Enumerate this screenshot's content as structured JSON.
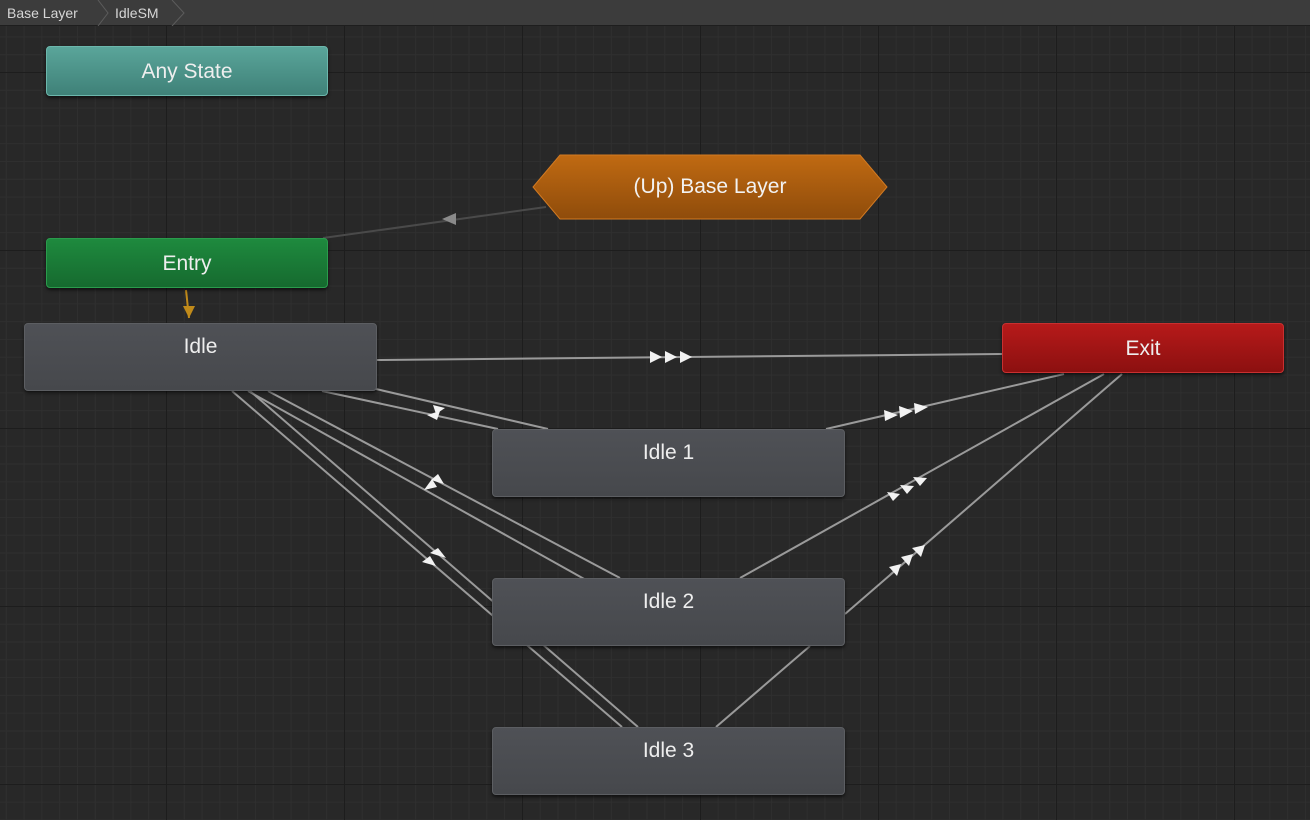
{
  "breadcrumb": {
    "items": [
      "Base Layer",
      "IdleSM"
    ]
  },
  "nodes": {
    "any_state": "Any State",
    "entry": "Entry",
    "up_base_layer": "(Up) Base Layer",
    "idle": "Idle",
    "exit": "Exit",
    "idle1": "Idle 1",
    "idle2": "Idle 2",
    "idle3": "Idle 3"
  },
  "colors": {
    "background": "#282828",
    "any_state": "#4f9a8f",
    "entry": "#1b7d38",
    "exit": "#a01414",
    "state_machine_up": "#b0600f",
    "state": "#4b4d51",
    "transition": "#9a9a9a",
    "entry_transition": "#c08a1a"
  }
}
